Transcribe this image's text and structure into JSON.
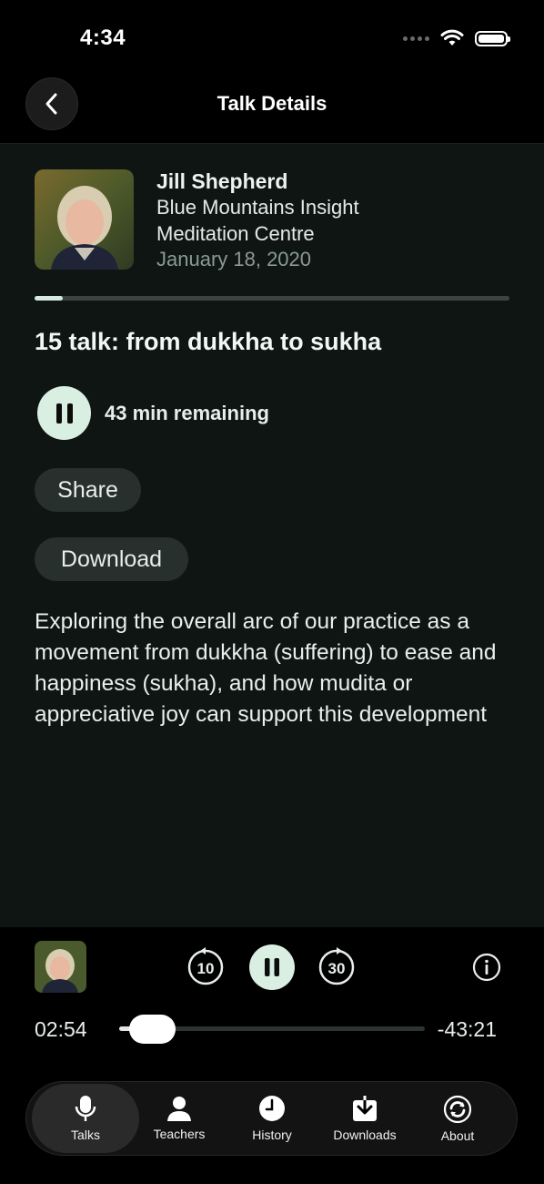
{
  "status_bar": {
    "time": "4:34"
  },
  "nav": {
    "title": "Talk Details"
  },
  "teacher": {
    "name": "Jill Shepherd",
    "center": "Blue Mountains Insight Meditation Centre",
    "date": "January 18, 2020"
  },
  "talk": {
    "playback_progress": 0.06,
    "title": "15 talk: from dukkha to sukha",
    "remaining": "43 min remaining",
    "share_label": "Share",
    "download_label": "Download",
    "description": "Exploring the overall arc of our practice as a movement from dukkha (suffering) to ease and happiness (sukha), and how mudita or appreciative joy can support this development"
  },
  "player": {
    "skip_back_seconds": "10",
    "skip_forward_seconds": "30",
    "elapsed": "02:54",
    "remaining": "-43:21",
    "progress": 0.06
  },
  "tabs": [
    {
      "label": "Talks",
      "icon": "mic-icon",
      "active": true
    },
    {
      "label": "Teachers",
      "icon": "person-icon",
      "active": false
    },
    {
      "label": "History",
      "icon": "clock-icon",
      "active": false
    },
    {
      "label": "Downloads",
      "icon": "download-icon",
      "active": false
    },
    {
      "label": "About",
      "icon": "refresh-icon",
      "active": false
    }
  ],
  "colors": {
    "accent": "#d9efe2",
    "panel": "#0f1513",
    "pill": "#27302c"
  }
}
